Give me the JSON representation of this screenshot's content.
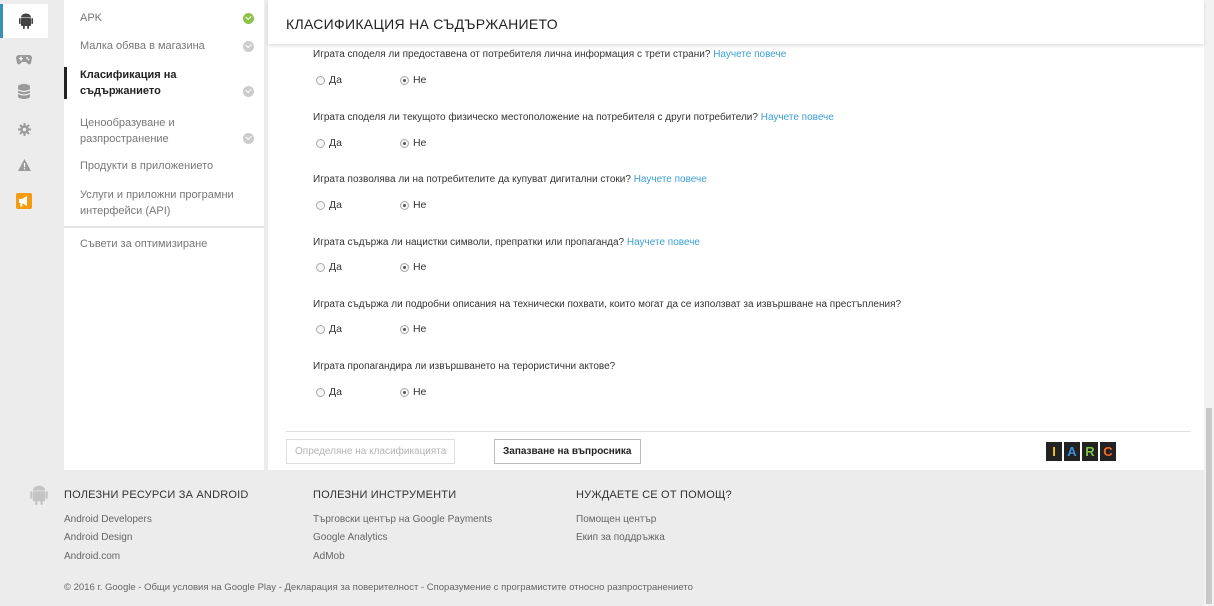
{
  "rail": {
    "icons": [
      "android-icon",
      "gamepad-icon",
      "database-icon",
      "gear-icon",
      "warning-icon",
      "megaphone-icon"
    ]
  },
  "nav": {
    "items": [
      {
        "label": "APK",
        "check": "green"
      },
      {
        "label": "Малка обява в магазина",
        "check": "grey"
      },
      {
        "label": "Класификация на съдържанието",
        "check": "grey"
      },
      {
        "label": "Ценообразуване и разпространение",
        "check": "grey"
      },
      {
        "label": "Продукти в приложението",
        "check": "none"
      },
      {
        "label": "Услуги и приложни програмни интерфейси (API)",
        "check": "none"
      },
      {
        "label": "Съвети за оптимизиране",
        "check": "none"
      }
    ]
  },
  "main": {
    "title": "КЛАСИФИКАЦИЯ НА СЪДЪРЖАНИЕТО",
    "learn_more": "Научете повече",
    "yes_label": "Да",
    "no_label": "Не",
    "questions": [
      {
        "text": "Играта споделя ли предоставена от потребителя лична информация с трети страни?",
        "has_link": true,
        "answer": "no"
      },
      {
        "text": "Играта споделя ли текущото физическо местоположение на потребителя с други потребители?",
        "has_link": true,
        "answer": "no"
      },
      {
        "text": "Играта позволява ли на потребителите да купуват дигитални стоки?",
        "has_link": true,
        "answer": "no"
      },
      {
        "text": "Играта съдържа ли нацистки символи, препратки или пропаганда?",
        "has_link": true,
        "answer": "no"
      },
      {
        "text": "Играта съдържа ли подробни описания на технически похвати, които могат да се използват за извършване на престъпления?",
        "has_link": false,
        "answer": "no"
      },
      {
        "text": "Играта пропагандира ли извършването на терористични актове?",
        "has_link": false,
        "answer": "no"
      }
    ],
    "btn_rating": "Определяне на класификацията",
    "btn_save": "Запазване на въпросника",
    "iarc": {
      "letters": [
        "I",
        "A",
        "R",
        "C"
      ],
      "colors": [
        "#f5c518",
        "#3b8fd9",
        "#7cc243",
        "#f26b21"
      ]
    }
  },
  "footer": {
    "col1": {
      "title": "ПОЛЕЗНИ РЕСУРСИ ЗА ANDROID",
      "links": [
        "Android Developers",
        "Android Design",
        "Android.com"
      ]
    },
    "col2": {
      "title": "ПОЛЕЗНИ ИНСТРУМЕНТИ",
      "links": [
        "Търговски център на Google Payments",
        "Google Analytics",
        "AdMob"
      ]
    },
    "col3": {
      "title": "НУЖДАЕТЕ СЕ ОТ ПОМОЩ?",
      "links": [
        "Помощен център",
        "Екип за поддръжка"
      ]
    },
    "copyright": "© 2016 г. Google - Общи условия на Google Play - Декларация за поверителност - Споразумение с програмистите относно разпространението"
  }
}
